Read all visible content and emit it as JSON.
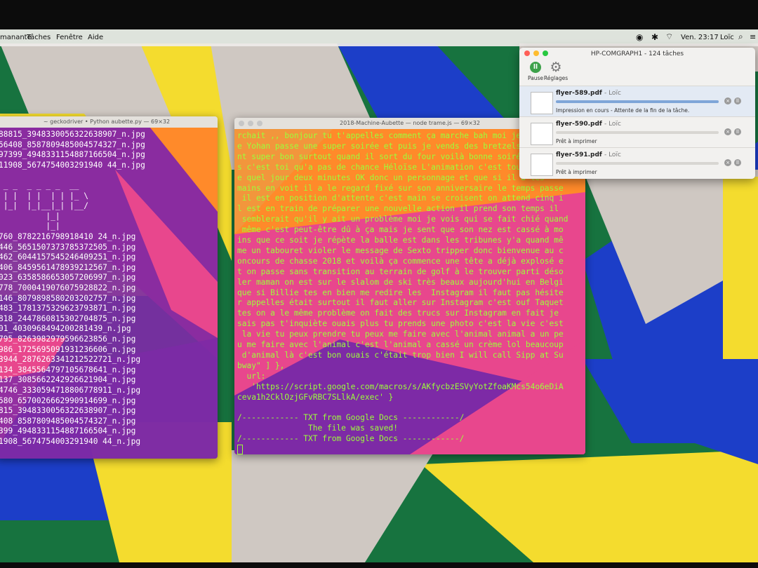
{
  "menubar": {
    "items": [
      "manante",
      "Tâches",
      "Fenêtre",
      "Aide"
    ],
    "clock": "Ven. 23:17",
    "user": "Loïc",
    "icons": [
      "creative-cloud-icon",
      "bluetooth-icon",
      "wifi-icon",
      "volume-icon",
      "search-icon"
    ]
  },
  "colors": {
    "term_text": "#9cff3a",
    "term_text_left": "#ffffff",
    "wallpaper": [
      "#17733f",
      "#1c3ec8",
      "#f4dc2e",
      "#ff8a2a",
      "#e8478d",
      "#7d2aa6",
      "#cfc8c2"
    ]
  },
  "left_terminal": {
    "title": "~ geckodriver • Python aubette.py — 69×32",
    "lines": [
      "88815_3948330056322638907_n.jpg",
      "56408_8587809485004574327_n.jpg",
      "97399_4948331154887166504_n.jpg",
      "11908_5674754003291940 44_n.jpg",
      "",
      " _ _  _ _ _ _  __",
      " | |  | |  | | |_ \\",
      " |_|  |_|__|_| |__/",
      "          |_|",
      "          |_|",
      "760_8782216798918410 24_n.jpg",
      "446_5651507373785372505_n.jpg",
      "462_6044157545246409251_n.jpg",
      "406_8459561478939212567_n.jpg",
      "023_6358586653057206997_n.jpg",
      "778_7000419076075928822_n.jpg",
      "146_8079898580203202757_n.jpg",
      "483_1781375329623793871_n.jpg",
      "818_2447860815302704875_n.jpg",
      "01_4030968494200281439_n.jpg",
      "795_8263982979596623856_n.jpg",
      "986_1725695091931236606_n.jpg",
      "3944_2876263341212522721_n.jpg",
      "134_3845564797105678641_n.jpg",
      "137_3085662242926621904_n.jpg",
      "4746_3330594718806778911_n.jpg",
      "580_6570026662990914699_n.jpg",
      "815_3948330056322638907_n.jpg",
      "408_8587809485004574327_n.jpg",
      "399_4948331154887166504_n.jpg",
      "1908_5674754003291940 44_n.jpg"
    ]
  },
  "right_terminal": {
    "title": "2018-Machine-Aubette — node trame.js — 69×32",
    "lines": [
      "rchait ,, bonjour tu t'appelles comment ça marche bah moi je m'appell",
      "e Yohan passe une super soirée et puis je vends des bretzels ils so",
      "nt super bon surtout quand il sort du four voilà bonne soirée merci",
      "s c'est toi qu'a pas de chance Héloïse L'animation c'est tous les jo",
      "e quel jour deux minutes OK donc un personnage et que si il a les",
      "mains en voit il a le regard fixé sur son anniversaire le temps passe",
      " il est en position d'attente c'est main se croisent on attend cinq i",
      "l est en train de préparer une nouvelle action il prend son temps il",
      " semblerait qu'il y ait un problème moi je vois qui se fait chié quand",
      " même c'est peut-être dû à ça mais je sent que son nez est cassé à mo",
      "ins que ce soit je répète la balle est dans les tribunes y'a quand mê",
      "me un tabouret violer le message de Sexto tripper donc bienvenue au c",
      "oncours de chasse 2018 et voilà ça commence une tête a déjà explosé e",
      "t on passe sans transition au terrain de golf à le trouver parti déso",
      "ler maman on est sur le slalom de ski très beaux aujourd'hui en Belgi",
      "que si Billie tes en bien me redire les  Instagram il faut pas hésite",
      "r appelles était surtout il faut aller sur Instagram c'est ouf Taquet",
      "tes on a le même problème on fait des trucs sur Instagram en fait je",
      "sais pas t'inquiète ouais plus tu prends une photo c'est la vie c'est",
      " la vie tu peux prendre tu peux me faire avec l'animal animal a un pe",
      "u me faire avec l'animal c'est l'animal a cassé un crème lol beaucoup",
      " d'animal là c'est bon ouais c'était trop bien I will call Sipp at Su",
      "bway\" ] },",
      "  url:",
      "   'https://script.google.com/macros/s/AKfycbzESVyYotZfoaKMcs54o6eDiA",
      "ceva1h2CklOzjGFvRBC7SLlkA/exec' }",
      "",
      "/------------ TXT from Google Docs ------------/",
      "               The file was saved!",
      "/------------ TXT from Google Docs ------------/"
    ]
  },
  "print_queue": {
    "title": "HP-COMGRAPH1 - 124 tâches",
    "pause_label": "Pause",
    "settings_label": "Réglages",
    "jobs": [
      {
        "file": "flyer-589.pdf",
        "user": "- Loïc",
        "status": "Impression en cours - Attente de la fin de la tâche.",
        "progress": 1.0
      },
      {
        "file": "flyer-590.pdf",
        "user": "- Loïc",
        "status": "Prêt à imprimer",
        "progress": 0
      },
      {
        "file": "flyer-591.pdf",
        "user": "- Loïc",
        "status": "Prêt à imprimer",
        "progress": 0
      }
    ]
  }
}
